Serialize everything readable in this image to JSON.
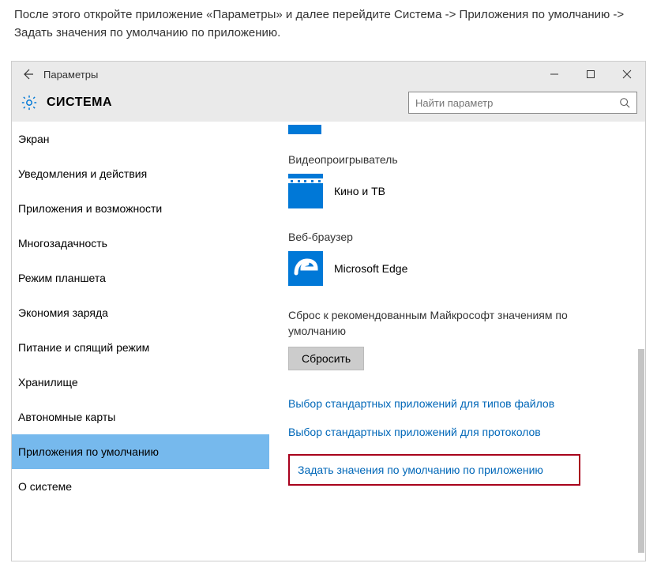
{
  "instruction": "После этого откройте приложение «Параметры» и далее перейдите Система -> Приложения по умолчанию -> Задать значения по умолчанию по приложению.",
  "window": {
    "title": "Параметры",
    "breadcrumb": "СИСТЕМА",
    "search_placeholder": "Найти параметр"
  },
  "sidebar": {
    "items": [
      "Экран",
      "Уведомления и действия",
      "Приложения и возможности",
      "Многозадачность",
      "Режим планшета",
      "Экономия заряда",
      "Питание и спящий режим",
      "Хранилище",
      "Автономные карты",
      "Приложения по умолчанию",
      "О системе"
    ],
    "selected_index": 9
  },
  "content": {
    "video": {
      "label": "Видеопроигрыватель",
      "app": "Кино и ТВ"
    },
    "browser": {
      "label": "Веб-браузер",
      "app": "Microsoft Edge"
    },
    "reset": {
      "text": "Сброс к рекомендованным Майкрософт значениям по умолчанию",
      "button": "Сбросить"
    },
    "links": {
      "file_types": "Выбор стандартных приложений для типов файлов",
      "protocols": "Выбор стандартных приложений для протоколов",
      "by_app": "Задать значения по умолчанию по приложению"
    }
  }
}
